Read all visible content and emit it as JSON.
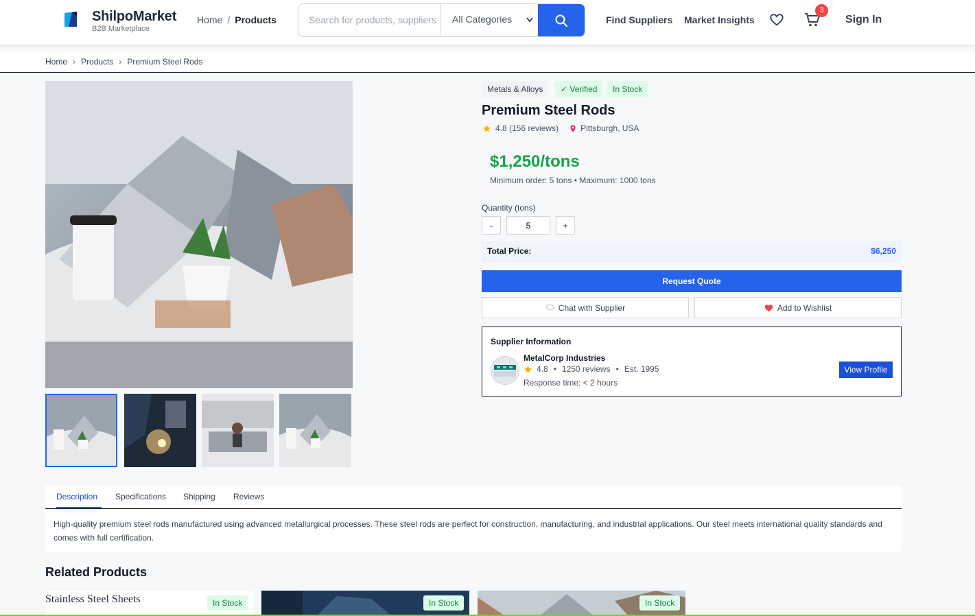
{
  "header": {
    "brand": "ShilpoMarket",
    "brand_sub": "B2B Marketplace",
    "crumb_home": "Home",
    "crumb_sep": "/",
    "crumb_current": "Products",
    "search_placeholder": "Search for products, suppliers",
    "category": "All Categories",
    "nav_find_suppliers": "Find Suppliers",
    "nav_market_insights": "Market Insights",
    "cart_count": "3",
    "sign_in": "Sign In"
  },
  "breadcrumb": {
    "items": [
      "Home",
      "Products",
      "Premium Steel Rods"
    ],
    "sep": "›"
  },
  "product": {
    "tags": {
      "category": "Metals & Alloys",
      "verified": "✓ Verified",
      "stock": "In Stock"
    },
    "title": "Premium Steel Rods",
    "rating": "4.8 (156 reviews)",
    "location": "Pittsburgh, USA",
    "price": "$1,250/tons",
    "min_order": "Minimum order: 5 tons • Maximum: 1000 tons",
    "quantity_label": "Quantity (tons)",
    "minus": "-",
    "plus": "+",
    "quantity": "5",
    "total_label": "Total Price:",
    "total_value": "$6,250",
    "request_quote": "Request Quote",
    "chat": "Chat with Supplier",
    "wishlist": "Add to Wishlist"
  },
  "supplier": {
    "heading": "Supplier Information",
    "name": "MetalCorp Industries",
    "rating": "4.8",
    "reviews": "1250 reviews",
    "established": "Est. 1995",
    "response": "Response time: < 2 hours",
    "view_profile": "View Profile"
  },
  "tabs": [
    "Description",
    "Specifications",
    "Shipping",
    "Reviews"
  ],
  "description": "High-quality premium steel rods manufactured using advanced metallurgical processes. These steel rods are perfect for construction, manufacturing, and industrial applications. Our steel meets international quality standards and comes with full certification.",
  "related": {
    "title": "Related Products",
    "first_alt": "Stainless Steel Sheets",
    "badge": "In Stock"
  },
  "colors": {
    "primary": "#2563eb",
    "price_green": "#16a34a",
    "badge_red": "#ef4444"
  }
}
